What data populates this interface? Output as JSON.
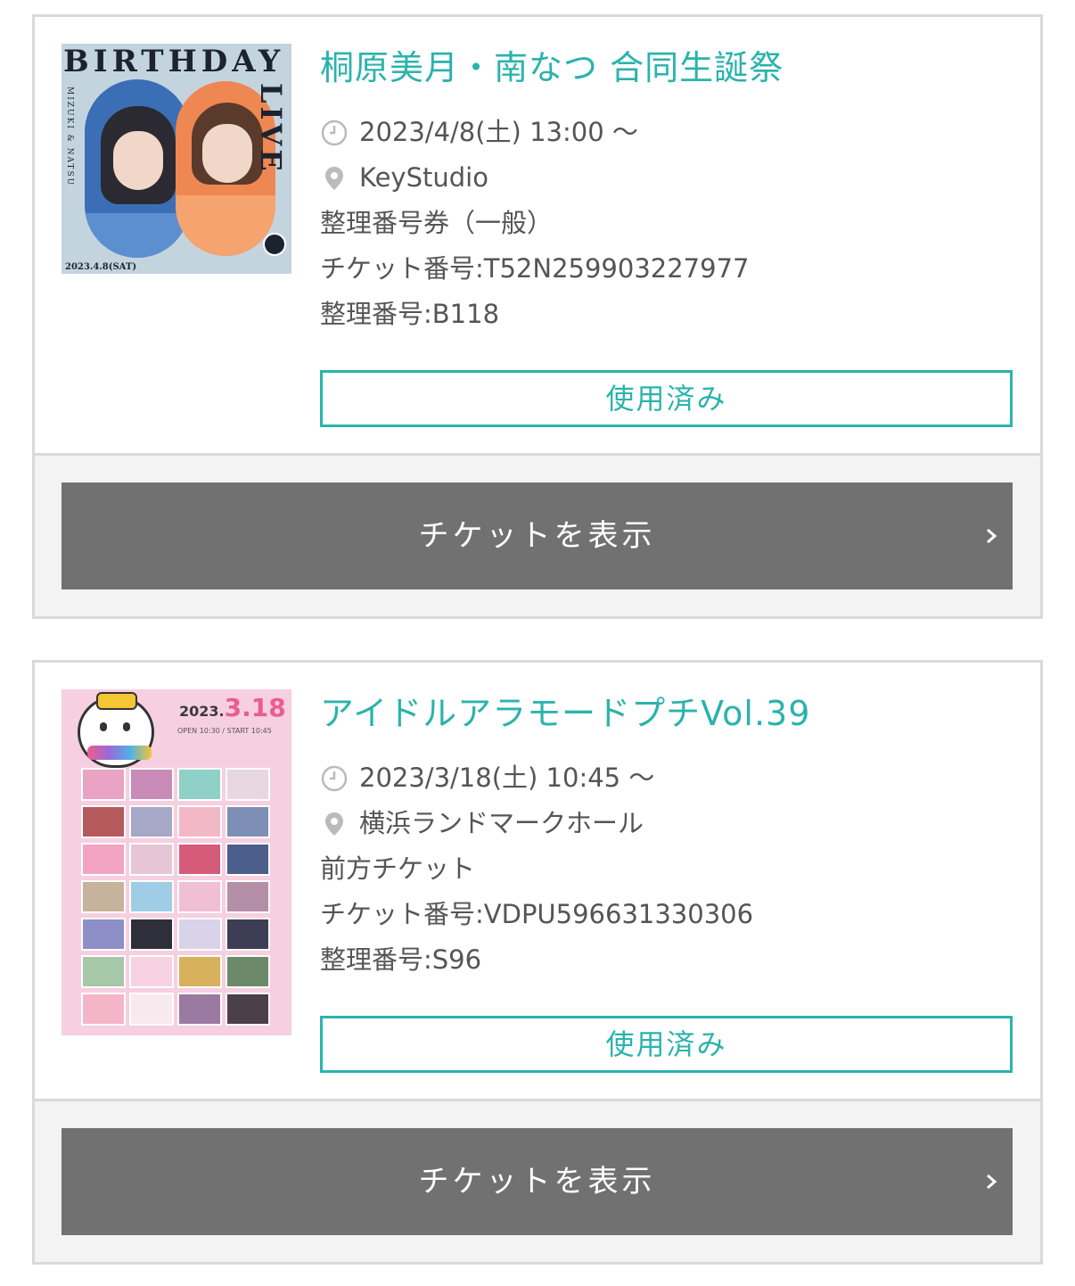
{
  "tickets": [
    {
      "event_title": "桐原美月・南なつ 合同生誕祭",
      "datetime": "2023/4/8(土) 13:00 ～",
      "venue": "KeyStudio",
      "ticket_type": "整理番号券（一般）",
      "ticket_number": "チケット番号:T52N259903227977",
      "seat_number": "整理番号:B118",
      "status_label": "使用済み",
      "view_label": "チケットを表示",
      "poster": {
        "title": "BIRTHDAY",
        "vertical_title": "LIVE",
        "side_text": "MIZUKI & NATSU",
        "date_text": "2023.4.8(SAT)"
      }
    },
    {
      "event_title": "アイドルアラモードプチVol.39",
      "datetime": "2023/3/18(土) 10:45 ～",
      "venue": "横浜ランドマークホール",
      "ticket_type": "前方チケット",
      "ticket_number": "チケット番号:VDPU596631330306",
      "seat_number": "整理番号:S96",
      "status_label": "使用済み",
      "view_label": "チケットを表示",
      "poster": {
        "date_year": "2023.",
        "date_day": "3.18",
        "sub_text": "OPEN 10:30 / START 10:45"
      }
    }
  ],
  "colors": {
    "accent": "#2bb3ad",
    "button_gray": "#717171",
    "border": "#d9d9d9",
    "footer_bg": "#f3f3f3",
    "text": "#555555"
  },
  "icons": {
    "time": "clock-icon",
    "place": "location-pin-icon",
    "more": "chevron-right-icon"
  }
}
